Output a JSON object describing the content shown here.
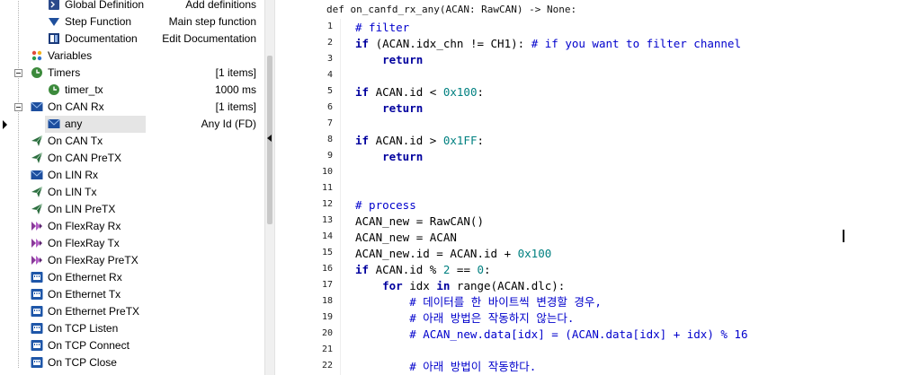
{
  "tree": {
    "rows": [
      {
        "label": "Global Definition",
        "value": "Add definitions",
        "icon": "script-icon",
        "indent": 2,
        "line": true
      },
      {
        "label": "Step Function",
        "value": "Main step function",
        "icon": "triangle-down-icon",
        "indent": 2,
        "line": true
      },
      {
        "label": "Documentation",
        "value": "Edit Documentation",
        "icon": "book-icon",
        "indent": 2,
        "line": false
      },
      {
        "label": "Variables",
        "value": "",
        "icon": "variables-icon",
        "indent": 1,
        "toggle": false
      },
      {
        "label": "Timers",
        "value": "[1 items]",
        "icon": "clock-icon",
        "indent": 1,
        "toggle": true
      },
      {
        "label": "timer_tx",
        "value": "1000 ms",
        "icon": "clock-icon",
        "indent": 2
      },
      {
        "label": "On CAN Rx",
        "value": "[1 items]",
        "icon": "envelope-icon",
        "indent": 1,
        "toggle": true
      },
      {
        "label": "any",
        "value": "Any Id (FD)",
        "icon": "envelope-icon",
        "indent": 2,
        "selected": true
      },
      {
        "label": "On CAN Tx",
        "value": "",
        "icon": "send-icon",
        "indent": 1
      },
      {
        "label": "On CAN PreTX",
        "value": "",
        "icon": "send-icon",
        "indent": 1
      },
      {
        "label": "On LIN Rx",
        "value": "",
        "icon": "envelope-icon",
        "indent": 1
      },
      {
        "label": "On LIN Tx",
        "value": "",
        "icon": "send-icon",
        "indent": 1
      },
      {
        "label": "On LIN PreTX",
        "value": "",
        "icon": "send-icon",
        "indent": 1
      },
      {
        "label": "On FlexRay Rx",
        "value": "",
        "icon": "flexray-icon",
        "indent": 1
      },
      {
        "label": "On FlexRay Tx",
        "value": "",
        "icon": "flexray-icon",
        "indent": 1
      },
      {
        "label": "On FlexRay PreTX",
        "value": "",
        "icon": "flexray-icon",
        "indent": 1
      },
      {
        "label": "On Ethernet Rx",
        "value": "",
        "icon": "ethernet-icon",
        "indent": 1
      },
      {
        "label": "On Ethernet Tx",
        "value": "",
        "icon": "ethernet-icon",
        "indent": 1
      },
      {
        "label": "On Ethernet PreTX",
        "value": "",
        "icon": "ethernet-icon",
        "indent": 1
      },
      {
        "label": "On TCP Listen",
        "value": "",
        "icon": "ethernet-icon",
        "indent": 1
      },
      {
        "label": "On TCP Connect",
        "value": "",
        "icon": "ethernet-icon",
        "indent": 1
      },
      {
        "label": "On TCP Close",
        "value": "",
        "icon": "ethernet-icon",
        "indent": 1
      }
    ]
  },
  "editor": {
    "signature": "def on_canfd_rx_any(ACAN: RawCAN) -> None:",
    "line_numbers": [
      "1",
      "2",
      "3",
      "4",
      "5",
      "6",
      "7",
      "8",
      "9",
      "10",
      "11",
      "12",
      "13",
      "14",
      "15",
      "16",
      "17",
      "18",
      "19",
      "20",
      "21",
      "22"
    ],
    "lines": [
      [
        {
          "t": "# filter",
          "c": "cm"
        }
      ],
      [
        {
          "t": "if",
          "c": "kw"
        },
        {
          "t": " (ACAN.idx_chn != CH1): ",
          "c": "str"
        },
        {
          "t": "# if you want to filter channel",
          "c": "cm"
        }
      ],
      [
        {
          "t": "    return",
          "c": "kw"
        }
      ],
      [],
      [
        {
          "t": "if",
          "c": "kw"
        },
        {
          "t": " ACAN.id < ",
          "c": "str"
        },
        {
          "t": "0x100",
          "c": "num"
        },
        {
          "t": ":",
          "c": "str"
        }
      ],
      [
        {
          "t": "    return",
          "c": "kw"
        }
      ],
      [],
      [
        {
          "t": "if",
          "c": "kw"
        },
        {
          "t": " ACAN.id > ",
          "c": "str"
        },
        {
          "t": "0x1FF",
          "c": "num"
        },
        {
          "t": ":",
          "c": "str"
        }
      ],
      [
        {
          "t": "    return",
          "c": "kw"
        }
      ],
      [],
      [],
      [
        {
          "t": "# process",
          "c": "cm"
        }
      ],
      [
        {
          "t": "ACAN_new = RawCAN()",
          "c": "str"
        }
      ],
      [
        {
          "t": "ACAN_new = ACAN",
          "c": "str"
        }
      ],
      [
        {
          "t": "ACAN_new.id = ACAN.id + ",
          "c": "str"
        },
        {
          "t": "0x100",
          "c": "num"
        }
      ],
      [
        {
          "t": "if",
          "c": "kw"
        },
        {
          "t": " ACAN.id % ",
          "c": "str"
        },
        {
          "t": "2",
          "c": "num"
        },
        {
          "t": " == ",
          "c": "str"
        },
        {
          "t": "0",
          "c": "num"
        },
        {
          "t": ":",
          "c": "str"
        }
      ],
      [
        {
          "t": "    for",
          "c": "kw"
        },
        {
          "t": " idx ",
          "c": "str"
        },
        {
          "t": "in",
          "c": "kw"
        },
        {
          "t": " range(ACAN.dlc):",
          "c": "str"
        }
      ],
      [
        {
          "t": "        # 데이터를 한 바이트씩 변경할 경우,",
          "c": "cm"
        }
      ],
      [
        {
          "t": "        # 아래 방법은 작동하지 않는다.",
          "c": "cm"
        }
      ],
      [
        {
          "t": "        # ACAN_new.data[idx] = (ACAN.data[idx] + idx) % 16",
          "c": "cm"
        }
      ],
      [],
      [
        {
          "t": "        # 아래 방법이 작동한다.",
          "c": "cm"
        }
      ]
    ]
  }
}
